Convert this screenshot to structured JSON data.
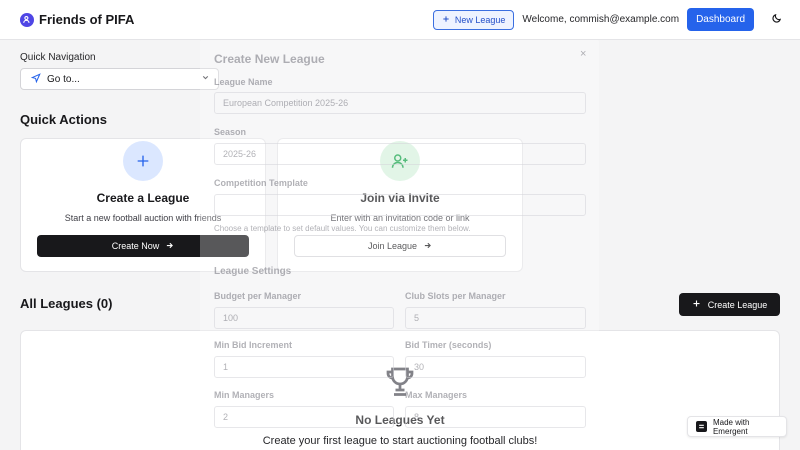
{
  "header": {
    "app_name": "Friends of PIFA",
    "new_league_label": "New League",
    "welcome_text": "Welcome, commish@example.com",
    "dashboard_label": "Dashboard"
  },
  "quick_nav": {
    "label": "Quick Navigation",
    "select_value": "Go to..."
  },
  "quick_actions": {
    "title": "Quick Actions",
    "create": {
      "title": "Create a League",
      "description": "Start a new football auction with friends",
      "button": "Create Now"
    },
    "join": {
      "title": "Join via Invite",
      "description": "Enter with an invitation code or link",
      "button": "Join League"
    }
  },
  "all_leagues": {
    "title": "All Leagues (0)",
    "create_button": "Create League",
    "empty_title": "No Leagues Yet",
    "empty_description": "Create your first league to start auctioning football clubs!"
  },
  "modal": {
    "title": "Create New League",
    "close": "×",
    "league_name_label": "League Name",
    "league_name_value": "European Competition 2025-26",
    "season_label": "Season",
    "season_value": "2025-26",
    "template_label": "Competition Template",
    "template_help": "Choose a template to set default values. You can customize them below.",
    "settings_title": "League Settings",
    "budget_label": "Budget per Manager",
    "budget_value": "100",
    "club_slots_label": "Club Slots per Manager",
    "club_slots_value": "5",
    "min_bid_label": "Min Bid Increment",
    "min_bid_value": "1",
    "bid_timer_label": "Bid Timer (seconds)",
    "bid_timer_value": "30",
    "min_managers_label": "Min Managers",
    "min_managers_value": "2",
    "max_managers_label": "Max Managers",
    "max_managers_value": "8"
  },
  "badge": {
    "label": "Made with Emergent"
  },
  "colors": {
    "primary": "#2563eb",
    "dark": "#18181b",
    "create_icon_bg": "#dbe7ff",
    "join_icon_bg": "#d7f2de"
  },
  "icons": [
    "users-icon",
    "plus-icon",
    "moon-icon",
    "navigation-icon",
    "chevron-down-icon",
    "user-plus-icon",
    "arrow-right-icon",
    "trophy-icon",
    "emergent-logo-icon"
  ]
}
